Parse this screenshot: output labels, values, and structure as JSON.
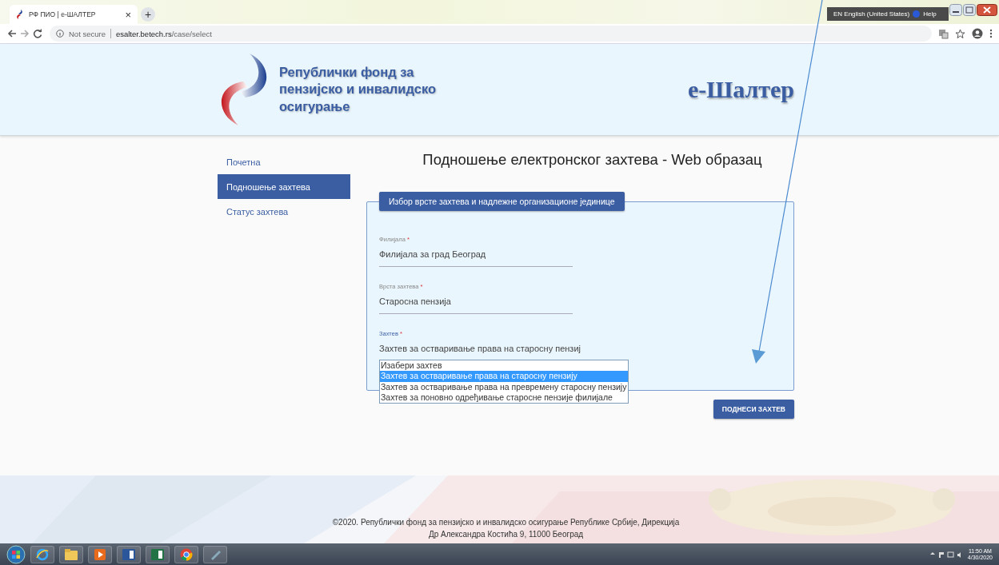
{
  "browser": {
    "tab_title": "РФ ПИО | е-ШАЛТЕР",
    "tab_close": "×",
    "new_tab": "+",
    "security": "Not secure",
    "url_host": "esalter.betech.rs",
    "url_path": "/case/select"
  },
  "language_bar": {
    "language": "EN English (United States)",
    "help": "Help"
  },
  "header": {
    "org_lines": [
      "Републички фонд за",
      "пензијско и инвалидско",
      "осигурање"
    ],
    "app_title": "е-Шалтер"
  },
  "sidebar": {
    "items": [
      {
        "label": "Почетна",
        "selected": false
      },
      {
        "label": "Подношење захтева",
        "selected": true
      },
      {
        "label": "Статус захтева",
        "selected": false
      }
    ]
  },
  "page_title": "Подношење електронског захтева - Web образац",
  "form": {
    "legend": "Избор врсте захтева и надлежне организационе јединице",
    "fields": [
      {
        "label": "Филијала",
        "mark": "*",
        "value": "Филијала за град Београд",
        "focused": false
      },
      {
        "label": "Врста захтева",
        "mark": "*",
        "value": "Старосна пензија",
        "focused": false
      },
      {
        "label": "Захтев",
        "mark": "*",
        "value": "Захтев за остваривање права на старосну пензиј",
        "focused": true
      }
    ],
    "dropdown": {
      "options": [
        {
          "label": "Изабери захтев",
          "selected": false
        },
        {
          "label": "Захтев за остваривање права на старосну пензију",
          "selected": true
        },
        {
          "label": "Захтев за остваривање права на превремену старосну пензију",
          "selected": false
        },
        {
          "label": "Захтев за поновно одређивање старосне пензије филијале",
          "selected": false
        }
      ]
    },
    "submit": "ПОДНЕСИ ЗАХТЕВ"
  },
  "footer": {
    "lines": [
      "©2020. Републички фонд за пензијско и инвалидско осигурање Републике Србије, Дирекција",
      "Др Александра Костића 9, 11000 Београд"
    ]
  },
  "taskbar": {
    "clock": "11:50 AM",
    "date": "4/30/2020"
  }
}
